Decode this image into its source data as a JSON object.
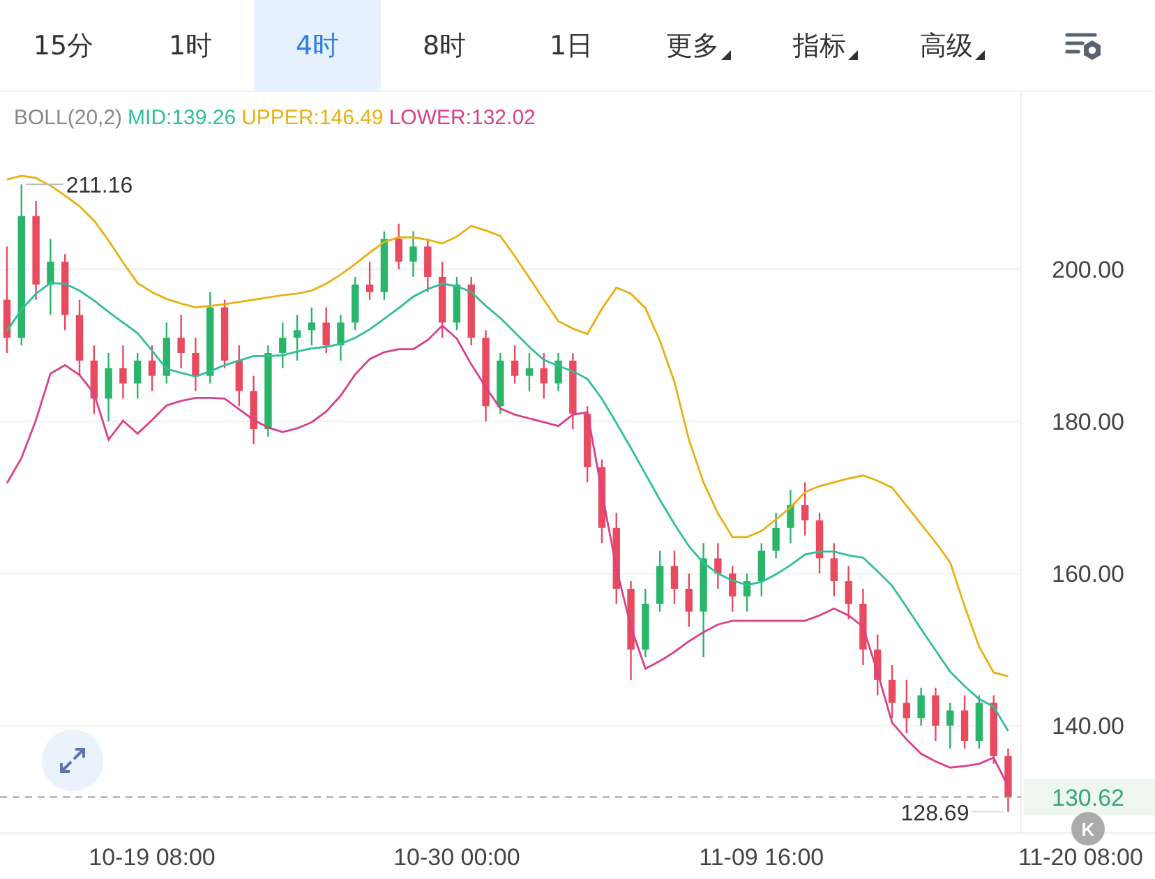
{
  "tabs": [
    {
      "label": "15分",
      "kind": "plain",
      "selected": false
    },
    {
      "label": "1时",
      "kind": "plain",
      "selected": false
    },
    {
      "label": "4时",
      "kind": "plain",
      "selected": true
    },
    {
      "label": "8时",
      "kind": "plain",
      "selected": false
    },
    {
      "label": "1日",
      "kind": "plain",
      "selected": false
    },
    {
      "label": "更多",
      "kind": "dropdown",
      "selected": false
    },
    {
      "label": "指标",
      "kind": "dropdown",
      "selected": false
    },
    {
      "label": "高级",
      "kind": "dropdown",
      "selected": false
    }
  ],
  "indicator": {
    "name": "BOLL(20,2)",
    "values": [
      {
        "text": ":139.26"
      },
      {
        "text": ":146.49"
      },
      {
        "text": ":132.02"
      }
    ]
  },
  "chart": {
    "chart_data": {
      "type": "candlestick",
      "categories": [
        null,
        null,
        null,
        null,
        null,
        null,
        null,
        null,
        null,
        null,
        "10-19 08:00",
        null,
        null,
        null,
        null,
        null,
        null,
        null,
        null,
        null,
        null,
        null,
        null,
        null,
        null,
        null,
        null,
        null,
        null,
        null,
        null,
        "10-30 00:00",
        null,
        null,
        null,
        null,
        null,
        null,
        null,
        null,
        null,
        null,
        null,
        null,
        null,
        null,
        null,
        null,
        null,
        null,
        null,
        null,
        "11-09 16:00",
        null,
        null,
        null,
        null,
        null,
        null,
        null,
        null,
        null,
        null,
        null,
        null,
        null,
        null,
        null,
        null,
        null,
        null,
        null,
        null,
        null,
        "11-20 08:00",
        null
      ],
      "ohlc": [
        [
          196,
          203,
          189,
          191
        ],
        [
          191,
          211.16,
          190,
          207
        ],
        [
          207,
          209,
          196,
          198
        ],
        [
          198,
          204,
          194,
          201
        ],
        [
          201,
          202,
          192,
          194
        ],
        [
          194,
          196,
          186,
          188
        ],
        [
          188,
          190,
          181,
          183
        ],
        [
          183,
          189,
          180,
          187
        ],
        [
          187,
          190,
          183,
          185
        ],
        [
          185,
          189,
          183,
          188
        ],
        [
          188,
          190,
          184,
          186
        ],
        [
          186,
          193,
          185,
          191
        ],
        [
          191,
          194,
          187,
          189
        ],
        [
          189,
          191,
          184,
          186
        ],
        [
          186,
          197,
          185,
          195
        ],
        [
          195,
          196,
          187,
          188
        ],
        [
          188,
          190,
          182,
          184
        ],
        [
          184,
          186,
          177,
          179
        ],
        [
          179,
          190,
          178,
          189
        ],
        [
          189,
          193,
          187,
          191
        ],
        [
          191,
          194,
          188,
          192
        ],
        [
          192,
          195,
          190,
          193
        ],
        [
          193,
          195,
          189,
          190
        ],
        [
          190,
          194,
          188,
          193
        ],
        [
          193,
          199,
          192,
          198
        ],
        [
          198,
          201,
          196,
          197
        ],
        [
          197,
          205,
          196,
          204
        ],
        [
          204,
          206,
          200,
          201
        ],
        [
          201,
          205,
          199,
          203
        ],
        [
          203,
          204,
          197,
          199
        ],
        [
          199,
          201,
          191,
          193
        ],
        [
          193,
          199,
          192,
          198
        ],
        [
          198,
          199,
          190,
          191
        ],
        [
          191,
          192,
          180,
          182
        ],
        [
          182,
          189,
          181,
          188
        ],
        [
          188,
          190,
          185,
          186
        ],
        [
          186,
          189,
          184,
          187
        ],
        [
          187,
          189,
          183,
          185
        ],
        [
          185,
          189,
          184,
          188
        ],
        [
          188,
          189,
          179,
          181
        ],
        [
          181,
          182,
          172,
          174
        ],
        [
          174,
          175,
          164,
          166
        ],
        [
          166,
          168,
          156,
          158
        ],
        [
          158,
          159,
          146,
          150
        ],
        [
          150,
          158,
          149,
          156
        ],
        [
          156,
          163,
          155,
          161
        ],
        [
          161,
          163,
          156,
          158
        ],
        [
          158,
          160,
          153,
          155
        ],
        [
          155,
          164,
          149,
          162
        ],
        [
          162,
          164,
          158,
          160
        ],
        [
          160,
          161,
          155,
          157
        ],
        [
          157,
          160,
          155,
          159
        ],
        [
          159,
          164,
          157,
          163
        ],
        [
          163,
          168,
          162,
          166
        ],
        [
          166,
          171,
          164,
          169
        ],
        [
          169,
          172,
          165,
          167
        ],
        [
          167,
          168,
          160,
          162
        ],
        [
          162,
          164,
          157,
          159
        ],
        [
          159,
          161,
          154,
          156
        ],
        [
          156,
          158,
          148,
          150
        ],
        [
          150,
          152,
          144,
          146
        ],
        [
          146,
          148,
          141,
          143
        ],
        [
          143,
          146,
          139,
          141
        ],
        [
          141,
          145,
          140,
          144
        ],
        [
          144,
          145,
          138,
          140
        ],
        [
          140,
          143,
          137,
          142
        ],
        [
          142,
          144,
          137,
          138
        ],
        [
          138,
          144,
          137,
          143
        ],
        [
          143,
          144,
          135,
          136
        ],
        [
          136,
          137,
          128.69,
          130.62
        ],
        null,
        null,
        null,
        null,
        null,
        null
      ],
      "series": [
        {
          "name": "MID",
          "type": "line",
          "color": "#2fbf9a",
          "values": [
            191.9,
            194.7,
            196.8,
            198.2,
            198.1,
            197.2,
            195.9,
            194.4,
            193,
            191.6,
            189.3,
            186.9,
            186.4,
            185.9,
            186.6,
            187.4,
            188,
            188.6,
            188.6,
            188.7,
            189.2,
            189.6,
            189.8,
            190.2,
            191,
            192.1,
            193.5,
            194.9,
            196.4,
            197.4,
            198.1,
            197.8,
            197,
            195.2,
            193.6,
            191.7,
            189.8,
            188.1,
            187.3,
            186.6,
            185.6,
            183,
            179.8,
            176.5,
            173.1,
            169.7,
            166.5,
            163.6,
            161.4,
            160,
            159.1,
            158.5,
            158.9,
            159.9,
            161.1,
            162.5,
            162.9,
            162.9,
            162.4,
            162.1,
            160.3,
            158.4,
            155.6,
            152.7,
            149.9,
            147.1,
            145.2,
            143.5,
            142.5,
            139.3,
            null,
            null,
            null,
            null,
            null,
            null
          ]
        },
        {
          "name": "UPPER",
          "type": "line",
          "color": "#e8b012",
          "values": [
            211.8,
            212.3,
            212,
            211,
            209.7,
            208.3,
            206.4,
            203.8,
            200.9,
            198.2,
            197,
            196.1,
            195.5,
            195,
            195.2,
            195.4,
            195.7,
            196,
            196.3,
            196.6,
            196.8,
            197.2,
            198.1,
            199.3,
            200.7,
            202.2,
            203.6,
            204.2,
            204.2,
            203.9,
            203.4,
            204.3,
            205.7,
            205.1,
            204.4,
            201.7,
            198.9,
            196,
            193.2,
            192.2,
            191.5,
            194.8,
            197.6,
            196.8,
            194.9,
            190.6,
            185.2,
            177.6,
            172,
            167.9,
            164.8,
            164.8,
            165.6,
            167.1,
            168.7,
            170.7,
            171.5,
            172,
            172.5,
            172.9,
            172.2,
            171.3,
            168.9,
            166.5,
            164.1,
            161.5,
            155.7,
            150.4,
            147,
            146.5,
            null,
            null,
            null,
            null,
            null,
            null
          ]
        },
        {
          "name": "LOWER",
          "type": "line",
          "color": "#d9408a",
          "values": [
            171.9,
            175.2,
            180.2,
            186.3,
            187.4,
            186.1,
            183.7,
            177.6,
            180.1,
            178.4,
            180.2,
            182.1,
            182.7,
            183.1,
            183.1,
            183,
            181.6,
            180.2,
            179.2,
            178.6,
            179.1,
            179.9,
            181.3,
            183.4,
            186.2,
            188.2,
            189.1,
            189.5,
            189.5,
            190.7,
            192.6,
            190.9,
            187.5,
            184.5,
            181.7,
            180.9,
            180.4,
            179.9,
            179.4,
            180.9,
            181.2,
            170.7,
            160.7,
            153,
            147.5,
            148.5,
            149.7,
            151.1,
            152.3,
            153.3,
            153.8,
            153.8,
            153.8,
            153.8,
            153.8,
            153.8,
            154.5,
            155.4,
            154.5,
            153,
            147,
            140.4,
            138.2,
            136.3,
            135.3,
            134.5,
            134.7,
            135,
            135.8,
            132,
            null,
            null,
            null,
            null,
            null,
            null
          ]
        }
      ],
      "ylim": [
        125.9,
        223.3
      ],
      "yticks": [
        {
          "value": 140,
          "label": "140.00"
        },
        {
          "value": 160,
          "label": "160.00"
        },
        {
          "value": 180,
          "label": "180.00"
        },
        {
          "value": 200,
          "label": "200.00"
        }
      ],
      "grid": true,
      "annotations": [
        "211.16",
        "128.69"
      ],
      "ref_lines": [
        {
          "axis": "y",
          "value": 130.62,
          "label": "130.62"
        }
      ]
    }
  },
  "kline_button": {
    "label": "K"
  }
}
